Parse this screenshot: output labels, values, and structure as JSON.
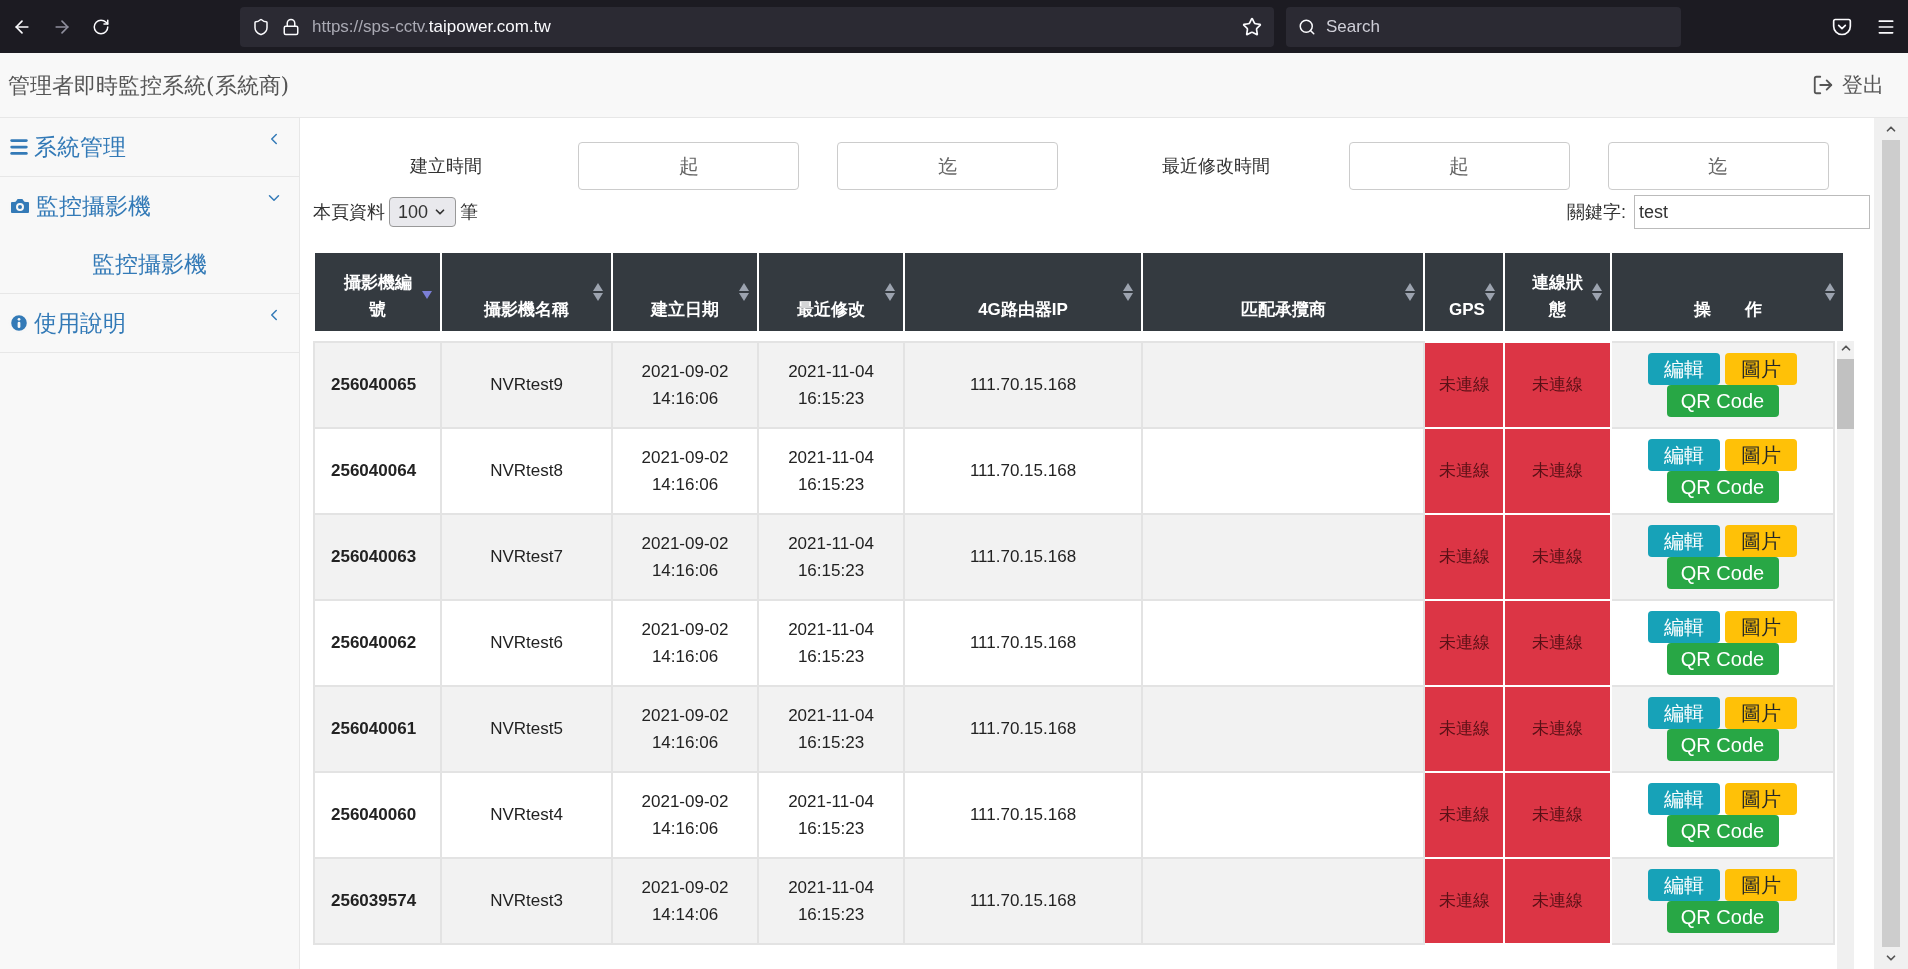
{
  "browser": {
    "url_prefix": "https://sps-cctv.",
    "url_domain": "taipower.com.tw",
    "search_placeholder": "Search"
  },
  "header": {
    "title": "管理者即時監控系統(系統商)",
    "logout": "登出"
  },
  "sidebar": {
    "items": [
      {
        "label": "系統管理",
        "expanded": false
      },
      {
        "label": "監控攝影機",
        "expanded": true,
        "children": [
          {
            "label": "監控攝影機"
          }
        ]
      },
      {
        "label": "使用說明",
        "expanded": false
      }
    ]
  },
  "filters": [
    {
      "label": "建立時間",
      "from_placeholder": "起",
      "to_placeholder": "迄"
    },
    {
      "label": "最近修改時間",
      "from_placeholder": "起",
      "to_placeholder": "迄"
    }
  ],
  "page_size": {
    "prefix": "本頁資料",
    "value": "100",
    "suffix": "筆"
  },
  "keyword": {
    "label": "關鍵字:",
    "value": "test"
  },
  "table": {
    "columns": [
      {
        "label": "攝影機編號",
        "sorted": true
      },
      {
        "label": "攝影機名稱",
        "sorted": false
      },
      {
        "label": "建立日期",
        "sorted": false
      },
      {
        "label": "最近修改",
        "sorted": false
      },
      {
        "label": "4G路由器IP",
        "sorted": false
      },
      {
        "label": "匹配承攬商",
        "sorted": false
      },
      {
        "label": "GPS",
        "sorted": false
      },
      {
        "label": "連線狀態",
        "sorted": false
      },
      {
        "label": "操　　作",
        "sorted": false
      }
    ],
    "rows": [
      {
        "id": "256040065",
        "name": "NVRtest9",
        "created_date": "2021-09-02",
        "created_time": "14:16:06",
        "modified_date": "2021-11-04",
        "modified_time": "16:15:23",
        "ip": "111.70.15.168",
        "gps": {
          "text": "未連線",
          "connected": false
        },
        "status": {
          "text": "未連線",
          "connected": false
        },
        "actions": [
          {
            "kind": "edit",
            "label": "編輯"
          },
          {
            "kind": "image",
            "label": "圖片"
          },
          {
            "kind": "qr",
            "label": "QR Code"
          }
        ]
      },
      {
        "id": "256040064",
        "name": "NVRtest8",
        "created_date": "2021-09-02",
        "created_time": "14:16:06",
        "modified_date": "2021-11-04",
        "modified_time": "16:15:23",
        "ip": "111.70.15.168",
        "gps": {
          "text": "未連線",
          "connected": false
        },
        "status": {
          "text": "未連線",
          "connected": false
        },
        "actions": [
          {
            "kind": "edit",
            "label": "編輯"
          },
          {
            "kind": "image",
            "label": "圖片"
          },
          {
            "kind": "qr",
            "label": "QR Code"
          }
        ]
      },
      {
        "id": "256040063",
        "name": "NVRtest7",
        "created_date": "2021-09-02",
        "created_time": "14:16:06",
        "modified_date": "2021-11-04",
        "modified_time": "16:15:23",
        "ip": "111.70.15.168",
        "gps": {
          "text": "未連線",
          "connected": false
        },
        "status": {
          "text": "未連線",
          "connected": false
        },
        "actions": [
          {
            "kind": "edit",
            "label": "編輯"
          },
          {
            "kind": "image",
            "label": "圖片"
          },
          {
            "kind": "qr",
            "label": "QR Code"
          }
        ]
      },
      {
        "id": "256040062",
        "name": "NVRtest6",
        "created_date": "2021-09-02",
        "created_time": "14:16:06",
        "modified_date": "2021-11-04",
        "modified_time": "16:15:23",
        "ip": "111.70.15.168",
        "gps": {
          "text": "未連線",
          "connected": false
        },
        "status": {
          "text": "未連線",
          "connected": false
        },
        "actions": [
          {
            "kind": "edit",
            "label": "編輯"
          },
          {
            "kind": "image",
            "label": "圖片"
          },
          {
            "kind": "qr",
            "label": "QR Code"
          }
        ]
      },
      {
        "id": "256040061",
        "name": "NVRtest5",
        "created_date": "2021-09-02",
        "created_time": "14:16:06",
        "modified_date": "2021-11-04",
        "modified_time": "16:15:23",
        "ip": "111.70.15.168",
        "gps": {
          "text": "未連線",
          "connected": false
        },
        "status": {
          "text": "未連線",
          "connected": false
        },
        "actions": [
          {
            "kind": "edit",
            "label": "編輯"
          },
          {
            "kind": "image",
            "label": "圖片"
          },
          {
            "kind": "qr",
            "label": "QR Code"
          }
        ]
      },
      {
        "id": "256040060",
        "name": "NVRtest4",
        "created_date": "2021-09-02",
        "created_time": "14:16:06",
        "modified_date": "2021-11-04",
        "modified_time": "16:15:23",
        "ip": "111.70.15.168",
        "gps": {
          "text": "未連線",
          "connected": false
        },
        "status": {
          "text": "未連線",
          "connected": false
        },
        "actions": [
          {
            "kind": "edit",
            "label": "編輯"
          },
          {
            "kind": "image",
            "label": "圖片"
          },
          {
            "kind": "qr",
            "label": "QR Code"
          }
        ]
      },
      {
        "id": "256039574",
        "name": "NVRtest3",
        "created_date": "2021-09-02",
        "created_time": "14:14:06",
        "modified_date": "2021-11-04",
        "modified_time": "16:15:23",
        "ip": "111.70.15.168",
        "gps": {
          "text": "未連線",
          "connected": false
        },
        "status": {
          "text": "未連線",
          "connected": false
        },
        "actions": [
          {
            "kind": "edit",
            "label": "編輯"
          },
          {
            "kind": "image",
            "label": "圖片"
          },
          {
            "kind": "qr",
            "label": "QR Code"
          }
        ]
      }
    ]
  }
}
